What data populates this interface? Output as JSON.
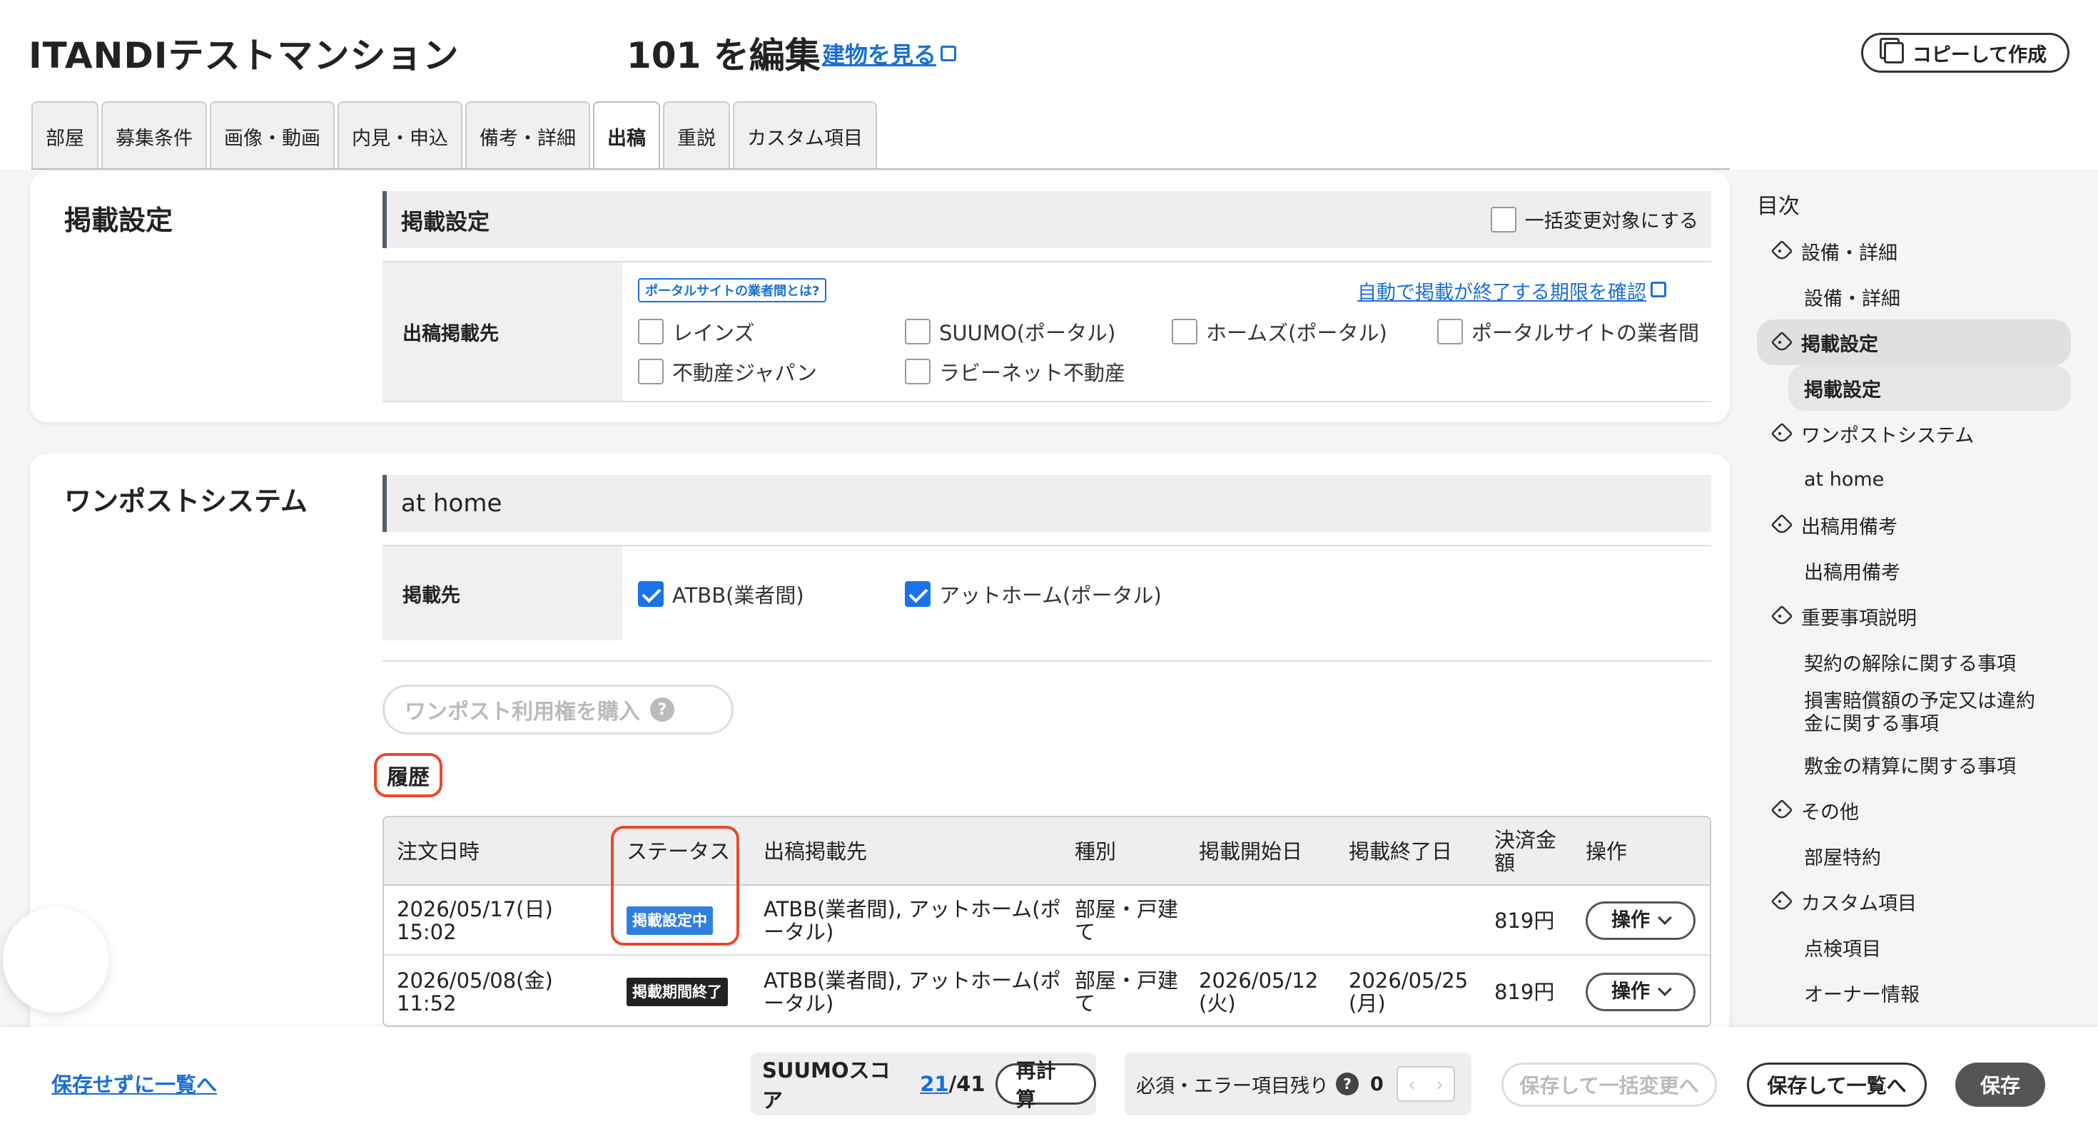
{
  "header": {
    "app_title": "ITANDIテストマンション",
    "edit_title": "101 を編集",
    "view_link": "建物を見る",
    "copy_button": "コピーして作成"
  },
  "tabs": [
    "部屋",
    "募集条件",
    "画像・動画",
    "内見・申込",
    "備考・詳細",
    "出稿",
    "重説",
    "カスタム項目"
  ],
  "active_tab": "出稿",
  "listing_settings": {
    "section_title": "掲載設定",
    "band_title": "掲載設定",
    "bulk_change_label": "一括変更対象にする",
    "row_label": "出稿掲載先",
    "portal_badge": "ポータルサイトの業者間とは?",
    "auto_end_link": "自動で掲載が終了する期限を確認",
    "options": [
      "レインズ",
      "SUUMO(ポータル)",
      "ホームズ(ポータル)",
      "ポータルサイトの業者間",
      "不動産ジャパン",
      "ラビーネット不動産"
    ]
  },
  "onepost": {
    "section_title": "ワンポストシステム",
    "band_title": "at home",
    "row_label": "掲載先",
    "options": [
      "ATBB(業者間)",
      "アットホーム(ポータル)"
    ],
    "purchase_button": "ワンポスト利用権を購入",
    "history_label": "履歴",
    "table": {
      "headers": [
        "注文日時",
        "ステータス",
        "出稿掲載先",
        "種別",
        "掲載開始日",
        "掲載終了日",
        "決済金額",
        "操作"
      ],
      "rows": [
        {
          "order_date": "2026/05/17(日)",
          "order_time": "15:02",
          "status": "掲載設定中",
          "dest_line1": "ATBB(業者間), アットホーム(ポ",
          "dest_line2": "ータル)",
          "type_line1": "部屋・戸建",
          "type_line2": "て",
          "start_line1": "",
          "start_line2": "",
          "end_line1": "",
          "end_line2": "",
          "amount": "819円",
          "op": "操作"
        },
        {
          "order_date": "2026/05/08(金)",
          "order_time": "11:52",
          "status": "掲載期間終了",
          "dest_line1": "ATBB(業者間), アットホーム(ポ",
          "dest_line2": "ータル)",
          "type_line1": "部屋・戸建",
          "type_line2": "て",
          "start_line1": "2026/05/12",
          "start_line2": "(火)",
          "end_line1": "2026/05/25",
          "end_line2": "(月)",
          "amount": "819円",
          "op": "操作"
        }
      ],
      "amount_header_line1": "決済金",
      "amount_header_line2": "額"
    }
  },
  "toc": {
    "title": "目次",
    "items": [
      {
        "label": "設備・詳細",
        "level": "parent"
      },
      {
        "label": "設備・詳細",
        "level": "child"
      },
      {
        "label": "掲載設定",
        "level": "parent"
      },
      {
        "label": "掲載設定",
        "level": "child"
      },
      {
        "label": "ワンポストシステム",
        "level": "parent"
      },
      {
        "label": "at home",
        "level": "child"
      },
      {
        "label": "出稿用備考",
        "level": "parent"
      },
      {
        "label": "出稿用備考",
        "level": "child"
      },
      {
        "label": "重要事項説明",
        "level": "parent"
      },
      {
        "label": "契約の解除に関する事項",
        "level": "child"
      },
      {
        "label": "損害賠償額の予定又は違約",
        "label2": "金に関する事項",
        "level": "child"
      },
      {
        "label": "敷金の精算に関する事項",
        "level": "child"
      },
      {
        "label": "その他",
        "level": "parent"
      },
      {
        "label": "部屋特約",
        "level": "child"
      },
      {
        "label": "カスタム項目",
        "level": "parent"
      },
      {
        "label": "点検項目",
        "level": "child"
      },
      {
        "label": "オーナー情報",
        "level": "child"
      }
    ]
  },
  "footer": {
    "back_link": "保存せずに一覧へ",
    "score_label": "SUUMOスコア",
    "score_value": "21",
    "score_total": "/41",
    "recalc_button": "再計算",
    "error_label": "必須・エラー項目残り",
    "error_count": "0",
    "bulk_save_button": "保存して一括変更へ",
    "save_list_button": "保存して一覧へ",
    "save_button": "保存"
  }
}
